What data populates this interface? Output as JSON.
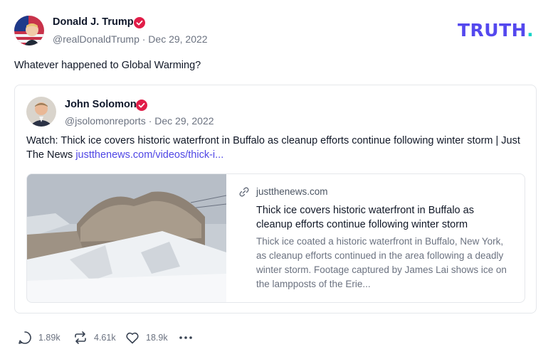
{
  "post": {
    "author_name": "Donald J. Trump",
    "author_handle_meta": "@realDonaldTrump · Dec 29, 2022",
    "text": "Whatever happened to Global Warming?"
  },
  "brand": {
    "name": "TRUTH",
    "dot": "."
  },
  "quote": {
    "author_name": "John Solomon",
    "author_handle_meta": "@jsolomonreports · Dec 29, 2022",
    "text": "Watch:  Thick ice covers historic waterfront in Buffalo as cleanup efforts continue following winter storm | Just The News ",
    "link_text": "justthenews.com/videos/thick-i..."
  },
  "link_card": {
    "domain": "justthenews.com",
    "title": "Thick ice covers historic waterfront in Buffalo as cleanup efforts continue following winter storm",
    "description": "Thick ice coated a historic waterfront in Buffalo, New York, as cleanup efforts continued in the area following a deadly winter storm. Footage captured by James Lai shows ice on the lampposts of the Erie..."
  },
  "actions": {
    "replies": "1.89k",
    "retruths": "4.61k",
    "likes": "18.9k"
  },
  "colors": {
    "brand": "#5448ee",
    "brand_dot": "#17d4c8",
    "verified": "#e11d48",
    "link": "#4f46e5"
  },
  "icons": [
    "verified-badge-icon",
    "link-icon",
    "reply-icon",
    "retruth-icon",
    "like-icon",
    "more-icon"
  ]
}
